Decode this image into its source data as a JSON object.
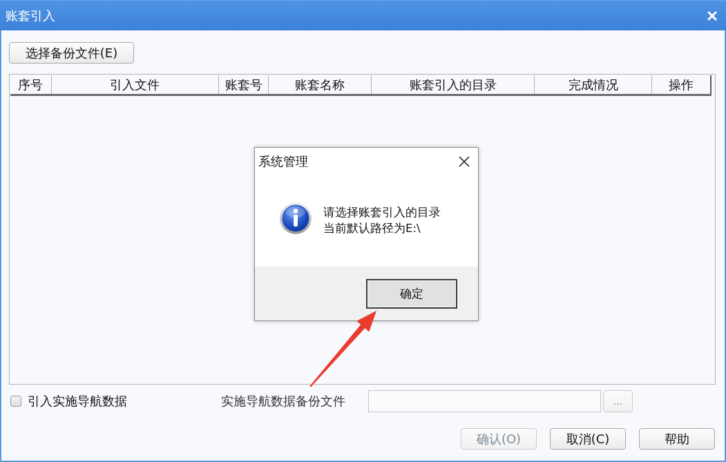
{
  "window": {
    "title": "账套引入"
  },
  "toolbar": {
    "select_button": {
      "label": "选择备份文件(E)"
    }
  },
  "table": {
    "columns": [
      {
        "label": "序号"
      },
      {
        "label": "引入文件"
      },
      {
        "label": "账套号"
      },
      {
        "label": "账套名称"
      },
      {
        "label": "账套引入的目录"
      },
      {
        "label": "完成情况"
      },
      {
        "label": "操作"
      }
    ]
  },
  "navigation_import": {
    "checkbox": {
      "label": "引入实施导航数据",
      "checked": false
    },
    "file_label": "实施导航数据备份文件",
    "browse_button": {
      "label": "...",
      "disabled": true
    }
  },
  "buttons": [
    {
      "label": "确认(O)",
      "disabled": true
    },
    {
      "label": "取消(C)",
      "disabled": false
    },
    {
      "label": "帮助",
      "disabled": false
    }
  ],
  "dialog": {
    "title": "系统管理",
    "message_lines": [
      "请选择账套引入的目录",
      "当前默认路径为E:\\"
    ],
    "buttons": [
      {
        "label": "确定",
        "default": true
      }
    ]
  }
}
